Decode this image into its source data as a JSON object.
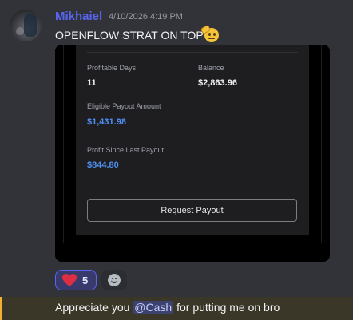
{
  "message": {
    "username": "Mikhaiel",
    "timestamp": "4/10/2026 4:19 PM",
    "text": "OPENFLOW STRAT ON TOP",
    "emoji": "saluting-face"
  },
  "card": {
    "profitable_days_label": "Profitable Days",
    "profitable_days_value": "11",
    "balance_label": "Balance",
    "balance_value": "$2,863.96",
    "eligible_payout_label": "Eligible Payout Amount",
    "eligible_payout_value": "$1,431.98",
    "profit_since_label": "Profit Since Last Payout",
    "profit_since_value": "$844.80",
    "request_payout_label": "Request Payout"
  },
  "reactions": {
    "heart_count": "5",
    "heart_emoji": "heart-icon",
    "add_icon": "add-reaction-icon"
  },
  "next_message": {
    "text_before": "Appreciate you ",
    "mention": "@Cash",
    "text_after": " for putting me on bro"
  },
  "colors": {
    "username": "#5865f2",
    "accent_blue": "#4f8ff0",
    "highlight_bar": "#f0b232"
  }
}
